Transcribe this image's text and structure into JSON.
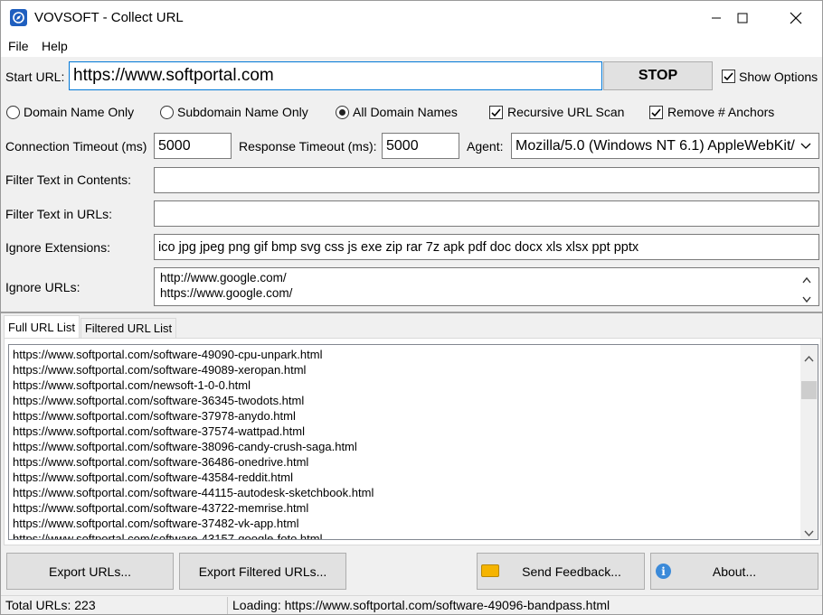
{
  "window": {
    "title": "VOVSOFT - Collect URL",
    "icon": "compass-icon"
  },
  "menu": [
    "File",
    "Help"
  ],
  "start_url": {
    "label": "Start URL:",
    "value": "https://www.softportal.com",
    "stop_label": "STOP",
    "show_options_label": "Show Options",
    "show_options_checked": true
  },
  "scope": {
    "options": [
      {
        "label": "Domain Name Only",
        "selected": false
      },
      {
        "label": "Subdomain Name Only",
        "selected": false
      },
      {
        "label": "All Domain Names",
        "selected": true
      }
    ],
    "recursive_label": "Recursive URL Scan",
    "recursive_checked": true,
    "anchors_label": "Remove # Anchors",
    "anchors_checked": true
  },
  "timeouts": {
    "connection_label": "Connection Timeout (ms)",
    "connection_value": "5000",
    "response_label": "Response Timeout (ms):",
    "response_value": "5000",
    "agent_label": "Agent:",
    "agent_value": "Mozilla/5.0 (Windows NT 6.1) AppleWebKit/"
  },
  "filters": {
    "contents_label": "Filter Text in Contents:",
    "contents_value": "",
    "urls_label": "Filter Text in URLs:",
    "urls_value": "",
    "extensions_label": "Ignore Extensions:",
    "extensions_value": "ico jpg jpeg png gif bmp svg css js exe zip rar 7z apk pdf doc docx xls xlsx ppt pptx",
    "ignore_urls_label": "Ignore URLs:",
    "ignore_urls_lines": [
      "http://www.google.com/",
      "https://www.google.com/"
    ]
  },
  "tabs": [
    {
      "label": "Full URL List",
      "active": true
    },
    {
      "label": "Filtered URL List",
      "active": false
    }
  ],
  "url_list": [
    "https://www.softportal.com/software-49090-cpu-unpark.html",
    "https://www.softportal.com/software-49089-xeropan.html",
    "https://www.softportal.com/newsoft-1-0-0.html",
    "https://www.softportal.com/software-36345-twodots.html",
    "https://www.softportal.com/software-37978-anydo.html",
    "https://www.softportal.com/software-37574-wattpad.html",
    "https://www.softportal.com/software-38096-candy-crush-saga.html",
    "https://www.softportal.com/software-36486-onedrive.html",
    "https://www.softportal.com/software-43584-reddit.html",
    "https://www.softportal.com/software-44115-autodesk-sketchbook.html",
    "https://www.softportal.com/software-43722-memrise.html",
    "https://www.softportal.com/software-37482-vk-app.html",
    "https://www.softportal.com/software-43157-google-foto.html"
  ],
  "buttons": {
    "export": "Export URLs...",
    "export_filtered": "Export Filtered URLs...",
    "feedback": "Send Feedback...",
    "about": "About..."
  },
  "status": {
    "total": "Total URLs: 223",
    "loading": "Loading: https://www.softportal.com/software-49096-bandpass.html"
  },
  "colors": {
    "window_bg": "#f0f0f0",
    "button_bg": "#e1e1e1",
    "icon_blue": "#1f5fbf",
    "feedback_icon": "#f5b400",
    "info_icon": "#3b8ad9"
  }
}
